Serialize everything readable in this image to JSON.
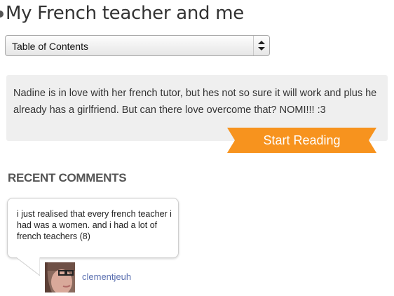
{
  "story": {
    "title": "My French teacher and me",
    "description": "Nadine is in love with her french tutor, but hes not so sure it will work and plus he already has a girlfriend. But can there love overcome that? NOMI!!! :3"
  },
  "toc": {
    "selected": "Table of Contents"
  },
  "actions": {
    "start_reading": "Start Reading",
    "accent_color": "#f7931e"
  },
  "comments": {
    "heading": "RECENT COMMENTS",
    "items": [
      {
        "text": "i just realised that every french teacher i had was a women. and i had a lot of french teachers (8)",
        "author": "clementjeuh",
        "avatar_icon": "user-avatar-photo"
      }
    ]
  },
  "icons": {
    "select_arrows": "updown-arrows-icon",
    "title_bullet": "bullet-dot-icon"
  }
}
